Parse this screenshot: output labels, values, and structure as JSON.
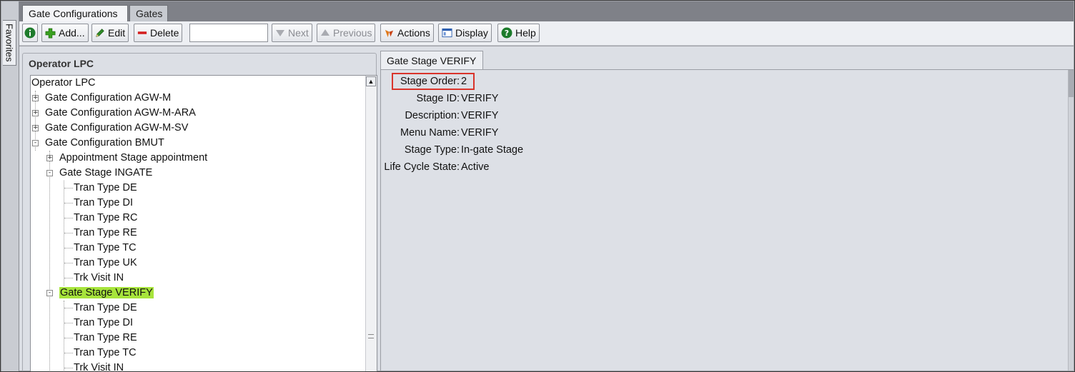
{
  "sidebar": {
    "favorites_label": "Favorites"
  },
  "tabs": [
    {
      "label": "Gate Configurations",
      "active": true
    },
    {
      "label": "Gates",
      "active": false
    }
  ],
  "toolbar": {
    "info_icon": "info-icon",
    "add_label": "Add...",
    "edit_label": "Edit",
    "delete_label": "Delete",
    "search_value": "",
    "next_label": "Next",
    "previous_label": "Previous",
    "actions_label": "Actions",
    "display_label": "Display",
    "help_label": "Help"
  },
  "tree": {
    "group_title": "Operator LPC",
    "root": "Operator LPC",
    "items": [
      {
        "label": "Gate Configuration AGW-M",
        "expander": "+"
      },
      {
        "label": "Gate Configuration AGW-M-ARA",
        "expander": "+"
      },
      {
        "label": "Gate Configuration AGW-M-SV",
        "expander": "+"
      },
      {
        "label": "Gate Configuration BMUT",
        "expander": "-"
      },
      {
        "label": "Appointment Stage appointment",
        "expander": "+"
      },
      {
        "label": "Gate Stage INGATE",
        "expander": "-"
      },
      {
        "label": "Tran Type DE"
      },
      {
        "label": "Tran Type DI"
      },
      {
        "label": "Tran Type RC"
      },
      {
        "label": "Tran Type RE"
      },
      {
        "label": "Tran Type TC"
      },
      {
        "label": "Tran Type UK"
      },
      {
        "label": "Trk Visit IN"
      },
      {
        "label": "Gate Stage VERIFY",
        "expander": "-",
        "selected": true
      },
      {
        "label": "Tran Type DE"
      },
      {
        "label": "Tran Type DI"
      },
      {
        "label": "Tran Type RE"
      },
      {
        "label": "Tran Type TC"
      },
      {
        "label": "Trk Visit IN"
      }
    ]
  },
  "detail": {
    "tab_label": "Gate Stage VERIFY",
    "fields": [
      {
        "label": "Stage Order:",
        "value": "2"
      },
      {
        "label": "Stage ID:",
        "value": "VERIFY"
      },
      {
        "label": "Description:",
        "value": "VERIFY"
      },
      {
        "label": "Menu Name:",
        "value": "VERIFY"
      },
      {
        "label": "Stage Type:",
        "value": "In-gate Stage"
      },
      {
        "label": "Life Cycle State:",
        "value": "Active"
      }
    ]
  },
  "colors": {
    "selection": "#a7e43c",
    "highlight_box": "#d9342b",
    "add_icon": "#3aa020",
    "delete_icon": "#d31d1d",
    "help_icon": "#1b7a2a"
  }
}
